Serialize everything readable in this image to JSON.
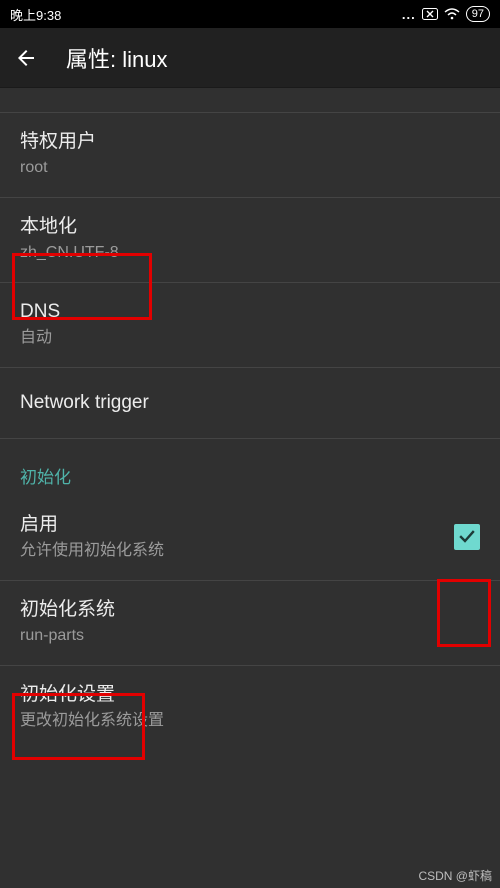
{
  "statusbar": {
    "time": "晚上9:38",
    "battery": "97"
  },
  "header": {
    "title": "属性: linux"
  },
  "items": {
    "priv": {
      "title": "特权用户",
      "sub": "root"
    },
    "locale": {
      "title": "本地化",
      "sub": "zh_CN.UTF-8"
    },
    "dns": {
      "title": "DNS",
      "sub": "自动"
    },
    "network": {
      "title": "Network trigger"
    }
  },
  "section": {
    "init_header": "初始化",
    "enable": {
      "title": "启用",
      "sub": "允许使用初始化系统",
      "checked": true
    },
    "initsys": {
      "title": "初始化系统",
      "sub": "run-parts"
    },
    "initset": {
      "title": "初始化设置",
      "sub": "更改初始化系统设置"
    }
  },
  "watermark": "CSDN @虾稿"
}
